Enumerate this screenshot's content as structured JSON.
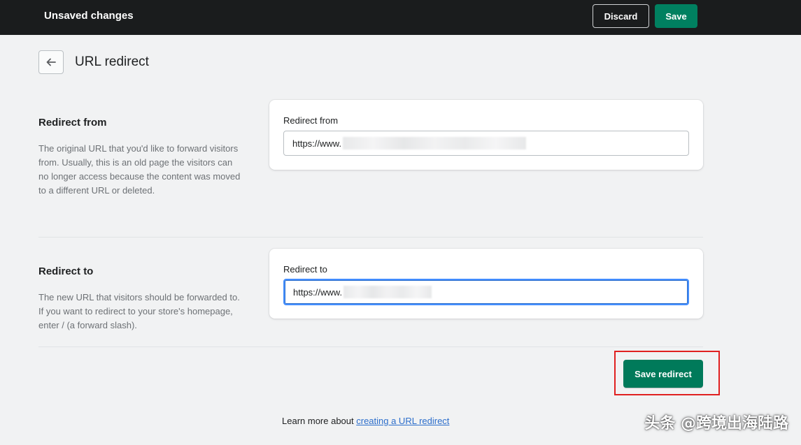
{
  "topbar": {
    "title": "Unsaved changes",
    "discard_label": "Discard",
    "save_label": "Save"
  },
  "page": {
    "title": "URL redirect",
    "back_icon": "arrow-left-icon"
  },
  "redirect_from": {
    "heading": "Redirect from",
    "description": "The original URL that you'd like to forward visitors from. Usually, this is an old page the visitors can no longer access because the content was moved to a different URL or deleted.",
    "field_label": "Redirect from",
    "field_value": "https://www."
  },
  "redirect_to": {
    "heading": "Redirect to",
    "description": "The new URL that visitors should be forwarded to. If you want to redirect to your store's homepage, enter / (a forward slash).",
    "field_label": "Redirect to",
    "field_value": "https://www."
  },
  "actions": {
    "save_redirect_label": "Save redirect"
  },
  "footer": {
    "learn_more_prefix": "Learn more about ",
    "learn_more_link": "creating a URL redirect"
  },
  "watermark": {
    "text": "头条 @跨境出海陆路"
  },
  "colors": {
    "topbar_bg": "#1a1c1d",
    "primary": "#008060",
    "link": "#2c6ecb",
    "focus": "#458fff",
    "highlight": "#e02020"
  }
}
